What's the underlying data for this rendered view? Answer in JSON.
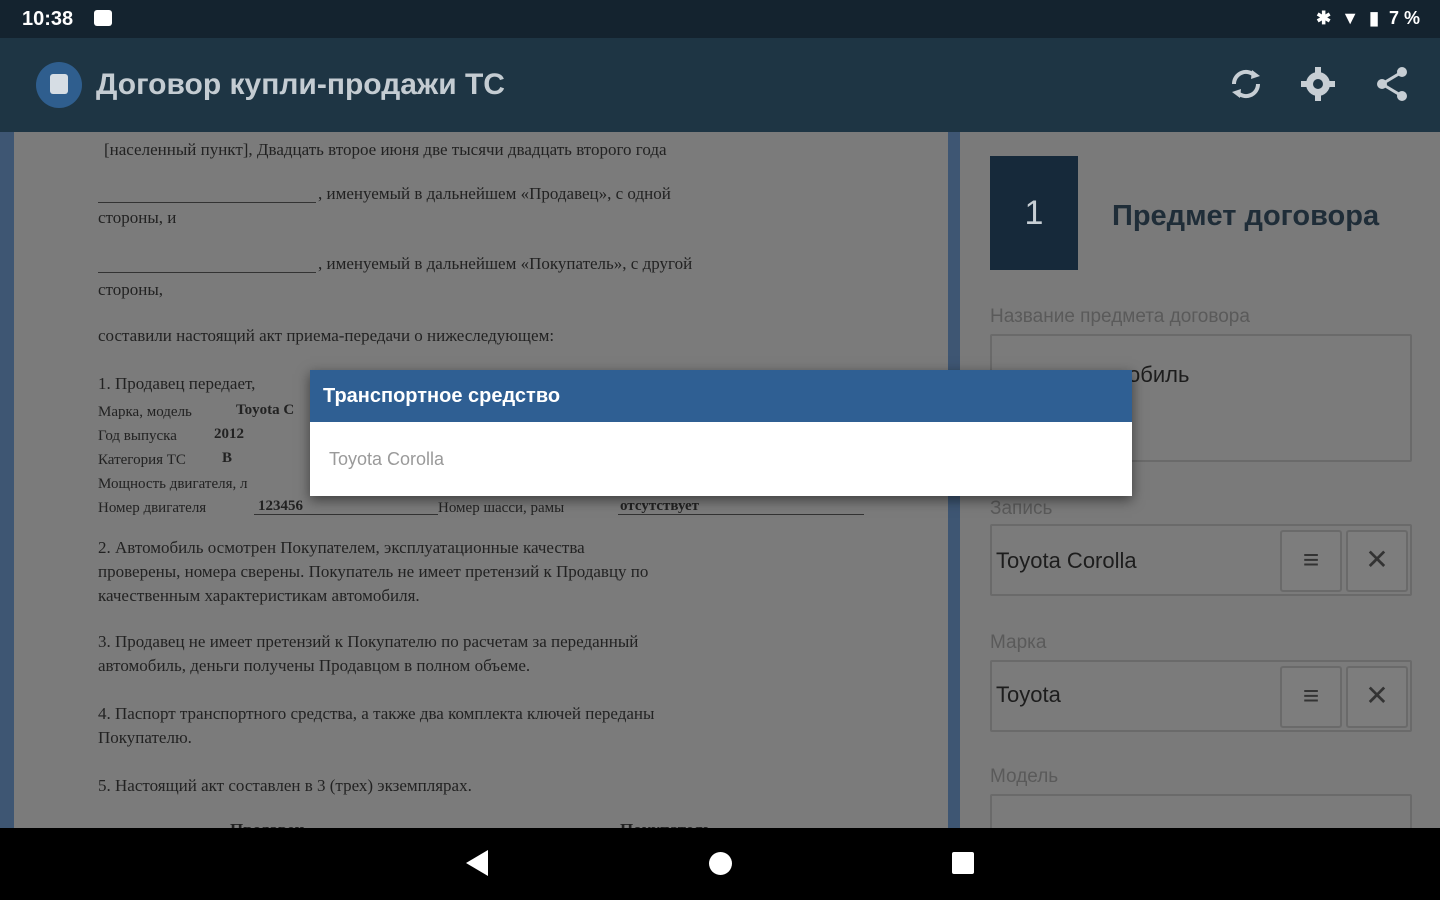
{
  "status_bar": {
    "time": "10:38",
    "battery": "7 %"
  },
  "app_bar": {
    "title": "Договор купли-продажи ТС"
  },
  "document": {
    "line1": "[населенный пункт], Двадцать второе июня две тысячи двадцать второго года",
    "seller_para_a": ", именуемый в дальнейшем «Продавец», с одной",
    "seller_para_b": "стороны, и",
    "buyer_para_a": ", именуемый в дальнейшем «Покупатель», с другой",
    "buyer_para_b": "стороны,",
    "act_line": "составили настоящий акт приема-передачи о нижеследующем:",
    "item1": "1. Продавец передает,",
    "brand_label": "Марка, модель",
    "brand_value": "Toyota C",
    "year_label": "Год выпуска",
    "year_value": "2012",
    "category_label": "Категория ТС",
    "category_value": "B",
    "power_label": "Мощность двигателя, л",
    "engine_label": "Номер двигателя",
    "engine_value": "123456",
    "chassis_label": "Номер шасси, рамы",
    "chassis_value": "отсутствует",
    "item2_a": "2. Автомобиль осмотрен Покупателем, эксплуатационные качества",
    "item2_b": "проверены, номера сверены. Покупатель не имеет претензий к Продавцу по",
    "item2_c": "качественным характеристикам автомобиля.",
    "item3_a": "3. Продавец не имеет претензий к Покупателю по расчетам за переданный",
    "item3_b": "автомобиль, деньги получены Продавцом в полном объеме.",
    "item4_a": "4. Паспорт транспортного средства, а также два комплекта ключей переданы",
    "item4_b": "Покупателю.",
    "item5": "5. Настоящий акт составлен в 3 (трех) экземплярах.",
    "sign_left": "Продавец",
    "sign_right": "Покупатель"
  },
  "form": {
    "section_number": "1",
    "section_title": "Предмет договора",
    "subject_label": "Название предмета договора",
    "subject_value": "обиль",
    "record_label": "Запись",
    "record_value": "Toyota Corolla",
    "brand_label": "Марка",
    "brand_value": "Toyota",
    "model_label": "Модель"
  },
  "dialog": {
    "title": "Транспортное средство",
    "option": "Toyota Corolla"
  },
  "icons": {
    "refresh": "refresh-icon",
    "settings": "gear-icon",
    "share": "share-icon",
    "menu": "menu-icon",
    "clear": "close-icon"
  },
  "colors": {
    "app_bar": "#1e3544",
    "dialog_header": "#2f5f93",
    "status_bar": "#14232f"
  }
}
